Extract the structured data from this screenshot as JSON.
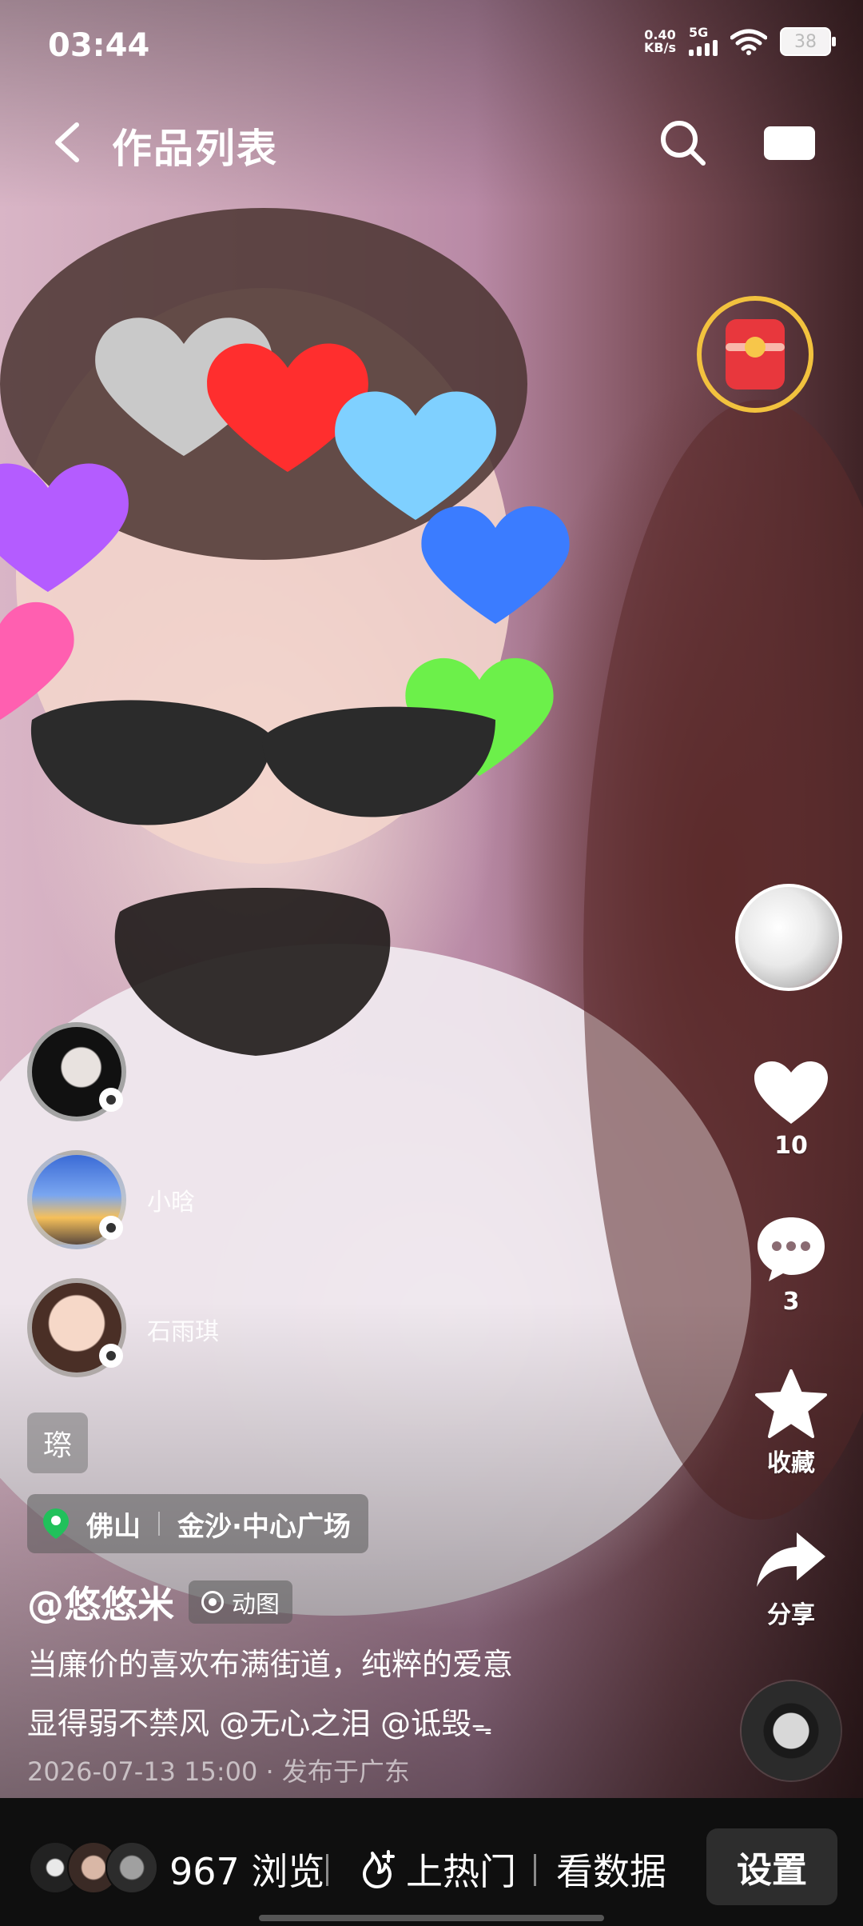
{
  "status_bar": {
    "time": "03:44",
    "net_speed_value": "0.40",
    "net_speed_unit": "KB/s",
    "network_type": "5G",
    "battery": "38"
  },
  "nav": {
    "title": "作品列表",
    "back_icon": "chevron-left-icon",
    "search_icon": "search-icon",
    "cast_icon": "cast-icon"
  },
  "actions": {
    "like_count": "10",
    "comment_count": "3",
    "favorite_label": "收藏",
    "share_label": "分享"
  },
  "visitors": [
    {
      "name": ""
    },
    {
      "name": "小晗"
    },
    {
      "name": "石雨琪"
    }
  ],
  "tag": "㻮",
  "location": {
    "city": "佛山",
    "place": "金沙·中心广场"
  },
  "author": {
    "name": "@悠悠米",
    "badge": "动图"
  },
  "description": {
    "line1": "当廉价的喜欢布满街道，纯粹的爱意",
    "line2": "显得弱不禁风 @无心之泪 @诋毁",
    "trailing_symbol": "ᯓ"
  },
  "meta": {
    "date": "2026-07-13 15:00",
    "published": "· 发布于广东"
  },
  "bottom_bar": {
    "views": "967 浏览",
    "hot_label": "上热门",
    "stats_label": "看数据",
    "settings_label": "设置"
  },
  "colors": {
    "accent_red": "#e8373d",
    "ring_gold": "#f2c23e",
    "pin_green": "#21c15b"
  }
}
